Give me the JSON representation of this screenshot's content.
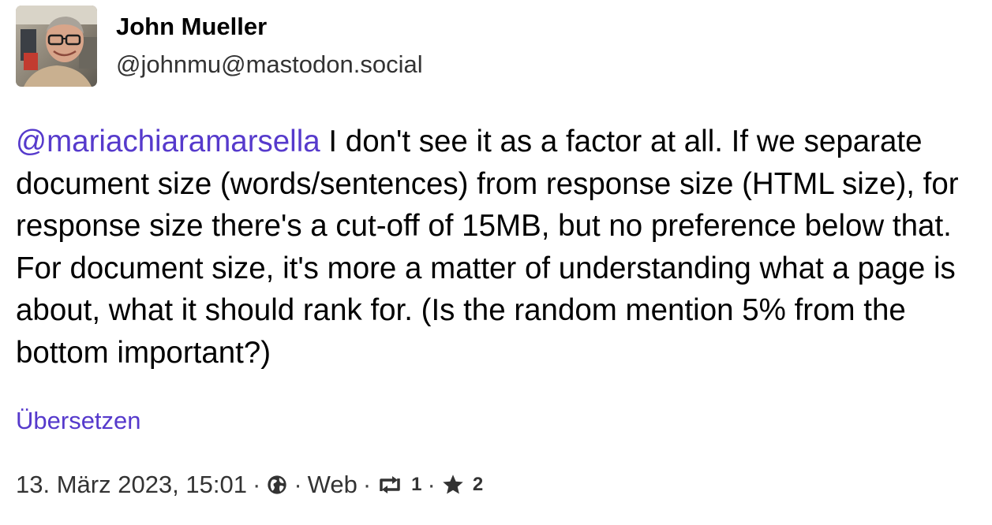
{
  "author": {
    "display_name": "John Mueller",
    "handle": "@johnmu@mastodon.social"
  },
  "post": {
    "mention": "@mariachiaramarsella",
    "text": " I don't see it as a factor at all. If we separate document size (words/sentences) from response size (HTML size), for response size there's a cut-off of 15MB, but no preference below that. For document size, it's more a matter of understanding what a page is about, what it should rank for. (Is the random mention 5% from the bottom important?)",
    "translate_label": "Übersetzen"
  },
  "meta": {
    "timestamp": "13. März 2023, 15:01",
    "visibility_icon": "globe-icon",
    "source": "Web",
    "separator": "·",
    "boost_icon": "boost-icon",
    "boost_count": "1",
    "favourite_icon": "star-icon",
    "favourite_count": "2"
  },
  "colors": {
    "link": "#563acc",
    "text": "#000000",
    "secondary": "#333333"
  }
}
